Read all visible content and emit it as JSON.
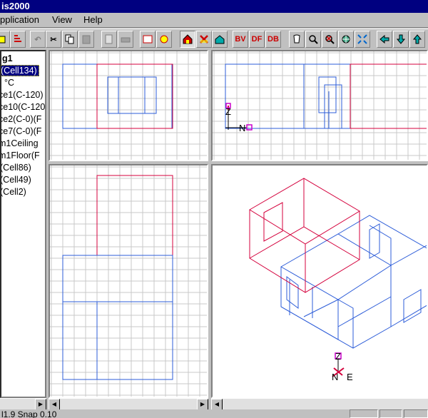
{
  "window": {
    "title": "is2000"
  },
  "menu": {
    "application_label": "pplication",
    "view_label": "View",
    "help_label": "Help"
  },
  "toolbar": {
    "bv_label": "BV",
    "df_label": "DF",
    "db_label": "DB"
  },
  "tree": {
    "items": [
      {
        "label": "g1"
      },
      {
        "label": "(Cell134)"
      },
      {
        "label": "°C"
      },
      {
        "label": "ce1(C-120)"
      },
      {
        "label": "ce10(C-120"
      },
      {
        "label": "ce2(C-0)(F"
      },
      {
        "label": "ce7(C-0)(F"
      },
      {
        "label": "m1Ceiling"
      },
      {
        "label": "m1Floor(F"
      },
      {
        "label": "(Cell86)"
      },
      {
        "label": "(Cell49)"
      },
      {
        "label": "(Cell2)"
      }
    ]
  },
  "views": {
    "front": {
      "axis_up": "Z",
      "axis_right": "N"
    },
    "iso": {
      "axis_up": "Z",
      "axis_n": "N",
      "axis_e": "E"
    }
  },
  "status": {
    "text": "l1.9 Snap 0.10"
  },
  "colors": {
    "grid": "#c8c8c8",
    "red_room": "#d4003c",
    "blue_room": "#2c5cd8",
    "axis_marker": "#cc00cc"
  }
}
